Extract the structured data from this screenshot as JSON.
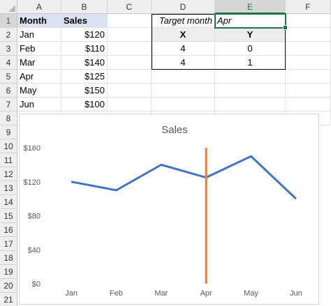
{
  "columns": [
    "A",
    "B",
    "C",
    "D",
    "E",
    "F"
  ],
  "rows": [
    "1",
    "2",
    "3",
    "4",
    "5",
    "6",
    "7",
    "8",
    "9",
    "10",
    "11",
    "12",
    "13",
    "14",
    "15",
    "16",
    "17",
    "18",
    "19",
    "20",
    "21"
  ],
  "selected_column": "E",
  "selected_row": "1",
  "table": {
    "headers": [
      "Month",
      "Sales"
    ],
    "rows": [
      [
        "Jan",
        "$120"
      ],
      [
        "Feb",
        "$110"
      ],
      [
        "Mar",
        "$140"
      ],
      [
        "Apr",
        "$125"
      ],
      [
        "May",
        "$150"
      ],
      [
        "Jun",
        "$100"
      ]
    ]
  },
  "target": {
    "label": "Target month",
    "value": "Apr",
    "x_header": "X",
    "y_header": "Y",
    "rows": [
      [
        "4",
        "0"
      ],
      [
        "4",
        "1"
      ]
    ]
  },
  "colors": {
    "line": "#4472c4",
    "vertical": "#ed7d31",
    "excel_green": "#217346",
    "header_fill": "#d9e1f2"
  },
  "chart_data": {
    "type": "line",
    "title": "Sales",
    "categories": [
      "Jan",
      "Feb",
      "Mar",
      "Apr",
      "May",
      "Jun"
    ],
    "series": [
      {
        "values": [
          120,
          110,
          140,
          125,
          150,
          100
        ]
      }
    ],
    "vertical_line_at": "Apr",
    "ylim": [
      0,
      160
    ],
    "yticks": [
      0,
      40,
      80,
      120,
      160
    ],
    "ytick_labels": [
      "$0",
      "$40",
      "$80",
      "$120",
      "$160"
    ],
    "grid": false
  }
}
